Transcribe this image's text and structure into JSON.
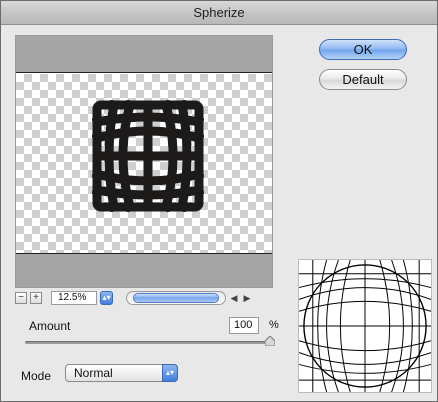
{
  "window": {
    "title": "Spherize"
  },
  "buttons": {
    "ok": "OK",
    "default": "Default"
  },
  "zoom": {
    "minus": "−",
    "plus": "+",
    "value": "12.5%",
    "stepper": "▴▾"
  },
  "scroll": {
    "left_arrow": "◀",
    "right_arrow": "▶"
  },
  "amount": {
    "label": "Amount",
    "value": "100",
    "unit": "%",
    "level": 1.0
  },
  "mode": {
    "label": "Mode",
    "value": "Normal",
    "caret": "▴▾"
  },
  "icons": {
    "zoom_out": "minus-icon",
    "zoom_in": "plus-icon",
    "stepper": "stepper-arrows-icon",
    "left": "left-arrow-icon",
    "right": "right-arrow-icon"
  },
  "colors": {
    "accent": "#6ea3ee",
    "window_bg": "#e8e8e8",
    "gray_band": "#a5a5a5"
  }
}
